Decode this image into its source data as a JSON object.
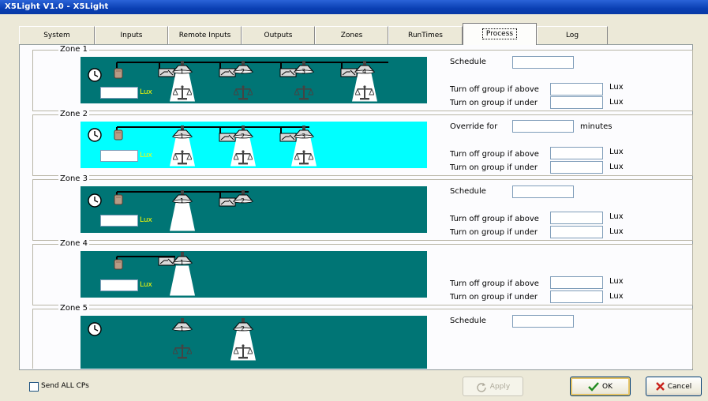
{
  "window": {
    "title": "X5Light V1.0 - X5Light"
  },
  "tabs": [
    {
      "label": "System"
    },
    {
      "label": "Inputs"
    },
    {
      "label": "Remote Inputs"
    },
    {
      "label": "Outputs"
    },
    {
      "label": "Zones"
    },
    {
      "label": "RunTimes"
    },
    {
      "label": "Process"
    },
    {
      "label": "Log"
    }
  ],
  "active_tab": "Process",
  "zones": [
    {
      "name": "Zone 1",
      "lux_unit": "Lux",
      "lights": [
        "1",
        "2",
        "3",
        "4"
      ],
      "top_label": "Schedule",
      "off_label": "Turn off group if above",
      "on_label": "Turn on group if under",
      "off_unit": "Lux",
      "on_unit": "Lux"
    },
    {
      "name": "Zone 2",
      "lux_unit": "Lux",
      "lights": [
        "1",
        "2",
        "3"
      ],
      "top_label": "Override for",
      "top_unit": "minutes",
      "off_label": "Turn off group if above",
      "on_label": "Turn on group if under",
      "off_unit": "Lux",
      "on_unit": "Lux"
    },
    {
      "name": "Zone 3",
      "lux_unit": "Lux",
      "lights": [
        "1",
        "2"
      ],
      "top_label": "Schedule",
      "off_label": "Turn off group if above",
      "on_label": "Turn on group if under",
      "off_unit": "Lux",
      "on_unit": "Lux"
    },
    {
      "name": "Zone 4",
      "lux_unit": "Lux",
      "lights": [
        "1"
      ],
      "off_label": "Turn off group if above",
      "on_label": "Turn on group if under",
      "off_unit": "Lux",
      "on_unit": "Lux"
    },
    {
      "name": "Zone 5",
      "lights": [
        "1",
        "2"
      ],
      "top_label": "Schedule"
    }
  ],
  "footer": {
    "send_all_label": "Send ALL CPs",
    "apply_label": "Apply",
    "ok_label": "OK",
    "cancel_label": "Cancel"
  },
  "colors": {
    "scene": "#007575",
    "scene_override": "#00ffff",
    "lux_text": "#ffff00",
    "titlebar": "#0a3fb3"
  }
}
